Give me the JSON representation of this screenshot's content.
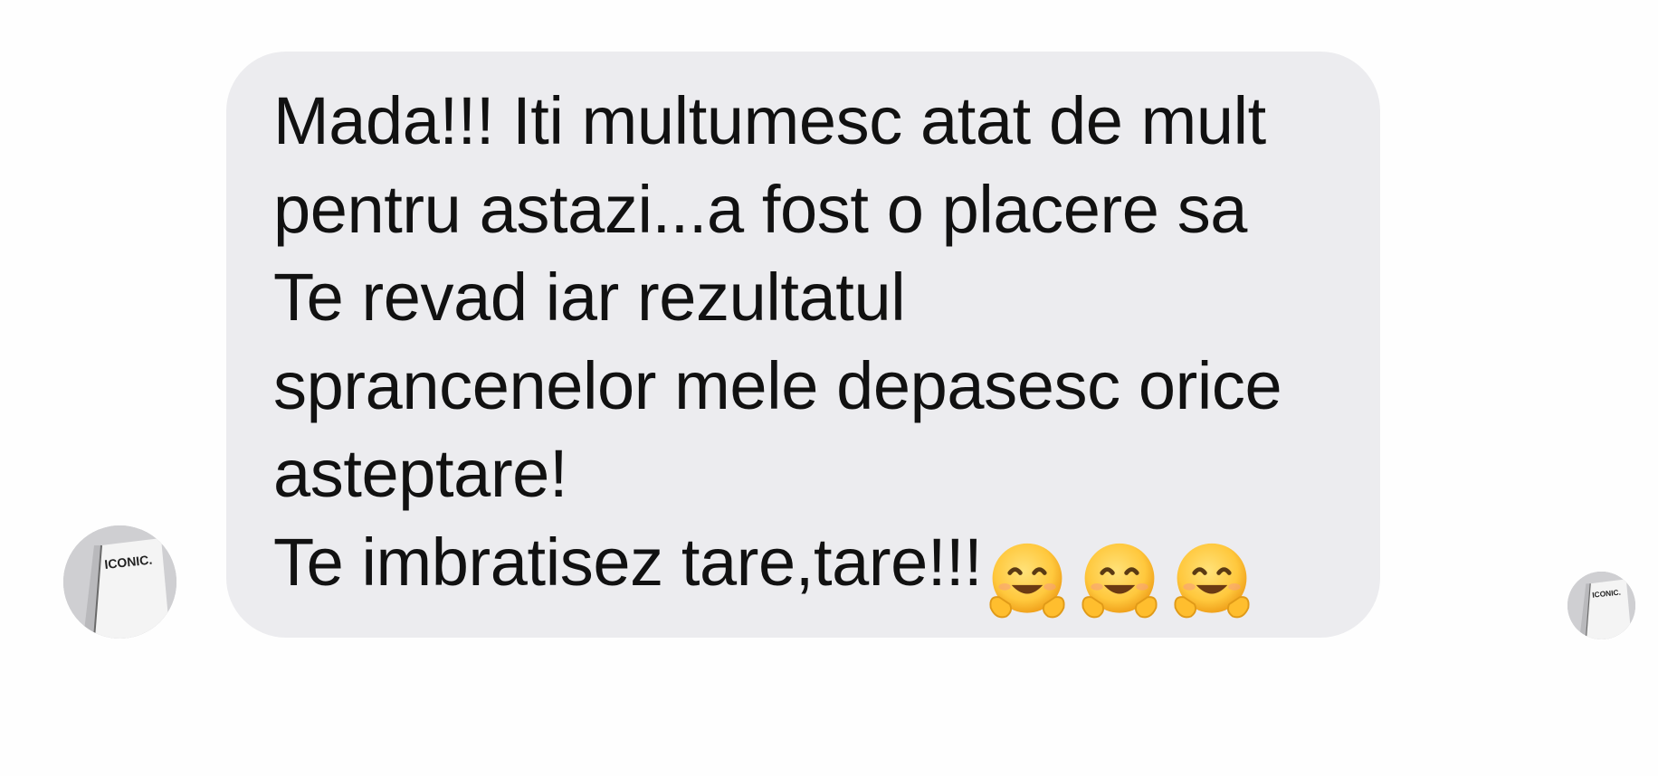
{
  "conversation": {
    "message": {
      "lines": [
        "Mada!!! Iti multumesc atat de mult",
        "pentru astazi...a fost o placere sa",
        "Te revad iar rezultatul",
        "sprancenelor mele depasesc orice",
        "asteptare!",
        "Te imbratisez tare,tare!!!"
      ],
      "emojis": [
        "hugging-face-icon",
        "hugging-face-icon",
        "hugging-face-icon"
      ]
    },
    "sender_avatar": {
      "label": "ICONIC."
    },
    "read_receipt_avatar": {
      "label": "ICONIC."
    }
  },
  "colors": {
    "bubble": "#ececef",
    "text": "#111111",
    "background": "#fefefe",
    "emoji_face": "#ffc83d"
  }
}
